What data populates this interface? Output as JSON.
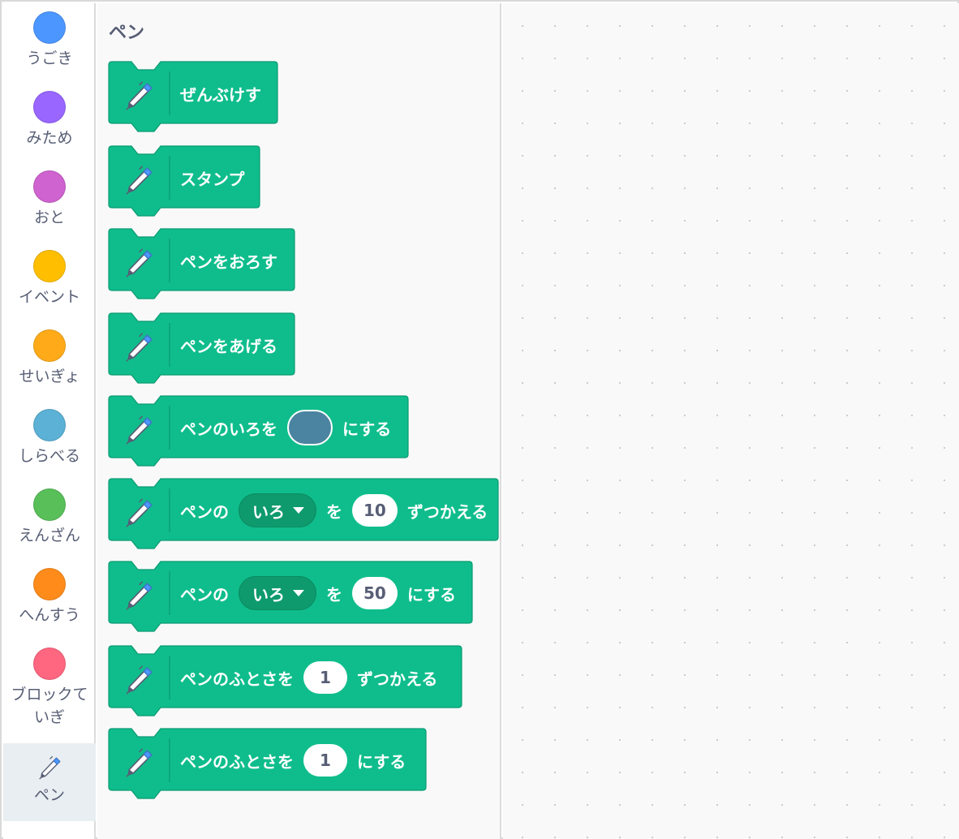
{
  "categories": [
    {
      "label": "うごき",
      "color": "#4c97ff"
    },
    {
      "label": "みため",
      "color": "#9966ff"
    },
    {
      "label": "おと",
      "color": "#cf63cf"
    },
    {
      "label": "イベント",
      "color": "#ffbf00"
    },
    {
      "label": "せいぎょ",
      "color": "#ffab19"
    },
    {
      "label": "しらべる",
      "color": "#5cb1d6"
    },
    {
      "label": "えんざん",
      "color": "#59c059"
    },
    {
      "label": "へんすう",
      "color": "#ff8c1a"
    },
    {
      "label": "ブロックて\nいぎ",
      "color": "#ff6680"
    },
    {
      "label": "ペン",
      "icon": "pen-icon"
    }
  ],
  "palette": {
    "title": "ペン",
    "block_color": "#0fbd8c",
    "blocks": [
      {
        "parts": [
          {
            "t": "text",
            "v": "ぜんぶけす"
          }
        ]
      },
      {
        "parts": [
          {
            "t": "text",
            "v": "スタンプ"
          }
        ]
      },
      {
        "parts": [
          {
            "t": "text",
            "v": "ペンをおろす"
          }
        ]
      },
      {
        "parts": [
          {
            "t": "text",
            "v": "ペンをあげる"
          }
        ]
      },
      {
        "parts": [
          {
            "t": "text",
            "v": "ペンのいろを"
          },
          {
            "t": "color",
            "v": "#4a84a0"
          },
          {
            "t": "text",
            "v": "にする"
          }
        ]
      },
      {
        "parts": [
          {
            "t": "text",
            "v": "ペンの"
          },
          {
            "t": "dropdown",
            "v": "いろ"
          },
          {
            "t": "text",
            "v": "を"
          },
          {
            "t": "number",
            "v": "10"
          },
          {
            "t": "text",
            "v": "ずつかえる"
          }
        ]
      },
      {
        "parts": [
          {
            "t": "text",
            "v": "ペンの"
          },
          {
            "t": "dropdown",
            "v": "いろ"
          },
          {
            "t": "text",
            "v": "を"
          },
          {
            "t": "number",
            "v": "50"
          },
          {
            "t": "text",
            "v": "にする"
          }
        ]
      },
      {
        "parts": [
          {
            "t": "text",
            "v": "ペンのふとさを"
          },
          {
            "t": "number",
            "v": "1"
          },
          {
            "t": "text",
            "v": "ずつかえる"
          }
        ]
      },
      {
        "parts": [
          {
            "t": "text",
            "v": "ペンのふとさを"
          },
          {
            "t": "number",
            "v": "1"
          },
          {
            "t": "text",
            "v": "にする"
          }
        ]
      }
    ]
  }
}
